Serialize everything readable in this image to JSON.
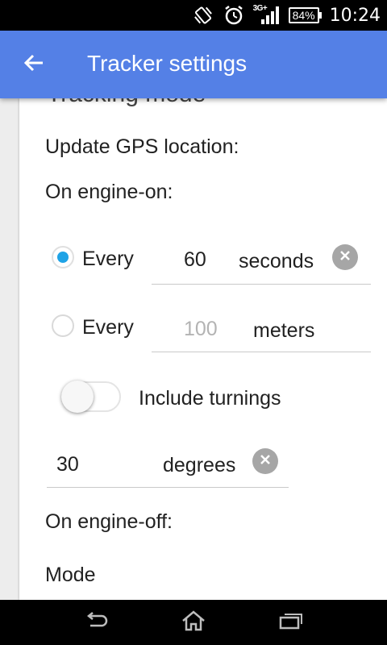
{
  "status_bar": {
    "network_label": "3G+",
    "battery_text": "84%",
    "time": "10:24",
    "icons": [
      "vibrate-icon",
      "alarm-icon",
      "signal-icon",
      "battery-icon"
    ]
  },
  "app_bar": {
    "title": "Tracker settings",
    "back_icon": "arrow-back-icon",
    "color": "#5480e6"
  },
  "content": {
    "section_title": "Tracking mode",
    "update_label": "Update GPS location:",
    "engine_on_label": "On engine-on:",
    "option_time": {
      "checked": true,
      "label": "Every",
      "value": "60",
      "unit": "seconds"
    },
    "option_distance": {
      "checked": false,
      "label": "Every",
      "placeholder": "100",
      "unit": "meters"
    },
    "turnings": {
      "enabled": false,
      "label": "Include turnings",
      "value": "30",
      "unit": "degrees"
    },
    "engine_off_label": "On engine-off:",
    "mode_label": "Mode"
  },
  "colors": {
    "accent": "#1fa3e6",
    "page_background": "#ededed",
    "clear_button": "#a6a6a6"
  },
  "nav_bar": {
    "icons": [
      "back-nav-icon",
      "home-nav-icon",
      "recents-nav-icon"
    ]
  }
}
